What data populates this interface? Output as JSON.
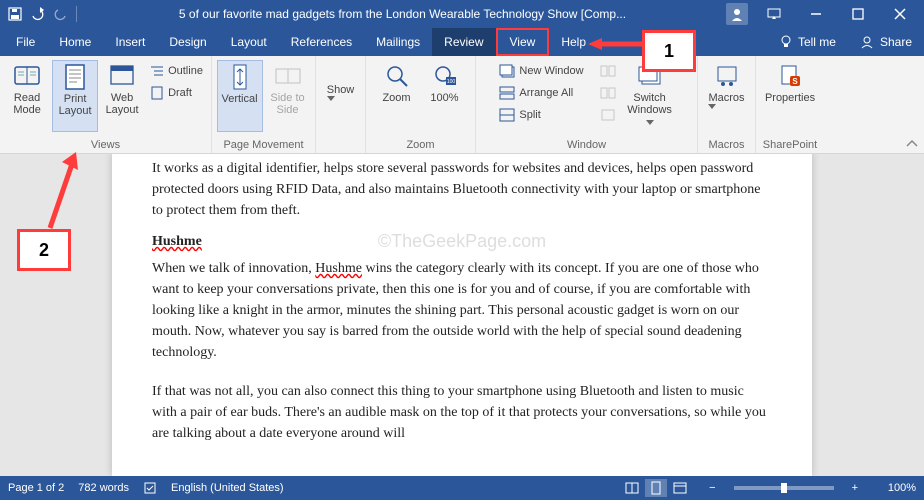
{
  "titlebar": {
    "title": "5 of our favorite mad gadgets from the London Wearable Technology Show [Comp..."
  },
  "tabs": {
    "file": "File",
    "home": "Home",
    "insert": "Insert",
    "design": "Design",
    "layout": "Layout",
    "references": "References",
    "mailings": "Mailings",
    "review": "Review",
    "view": "View",
    "help": "Help",
    "tell_me": "Tell me",
    "share": "Share"
  },
  "ribbon": {
    "views": {
      "read_mode": "Read\nMode",
      "print_layout": "Print\nLayout",
      "web_layout": "Web\nLayout",
      "outline": "Outline",
      "draft": "Draft",
      "group": "Views"
    },
    "page_movement": {
      "vertical": "Vertical",
      "side_to_side": "Side to\nSide",
      "group": "Page Movement"
    },
    "zoom": {
      "show": "Show",
      "zoom": "Zoom",
      "hundred": "100%",
      "group": "Zoom"
    },
    "window": {
      "new_window": "New Window",
      "arrange_all": "Arrange All",
      "split": "Split",
      "switch_windows": "Switch\nWindows",
      "group": "Window"
    },
    "macros": {
      "macros": "Macros",
      "group": "Macros"
    },
    "sharepoint": {
      "properties": "Properties",
      "group": "SharePoint"
    }
  },
  "document": {
    "p1": "It works as a digital identifier, helps store several passwords for websites and devices, helps open password protected doors using RFID Data, and also maintains Bluetooth connectivity with your laptop or smartphone to protect them from theft.",
    "heading": "Hushme",
    "p2a": "When we talk of innovation, ",
    "p2b": "Hushme",
    "p2c": " wins the category clearly with its concept. If you are one of those who want to keep your conversations private, then this one is for you and of course, if you are comfortable with looking like a knight in the armor, minutes the shining part. This personal acoustic gadget is worn on our mouth. Now, whatever you say is barred from the outside world with the help of special sound deadening technology.",
    "p3": "If that was not all, you can also connect this thing to your smartphone using Bluetooth and listen to music with a pair of ear buds. There's an audible mask on the top of it that protects your conversations, so while you are talking about a date everyone around will",
    "watermark": "©TheGeekPage.com"
  },
  "statusbar": {
    "page": "Page 1 of 2",
    "words": "782 words",
    "language": "English (United States)",
    "zoom": "100%"
  },
  "callouts": {
    "c1": "1",
    "c2": "2"
  }
}
